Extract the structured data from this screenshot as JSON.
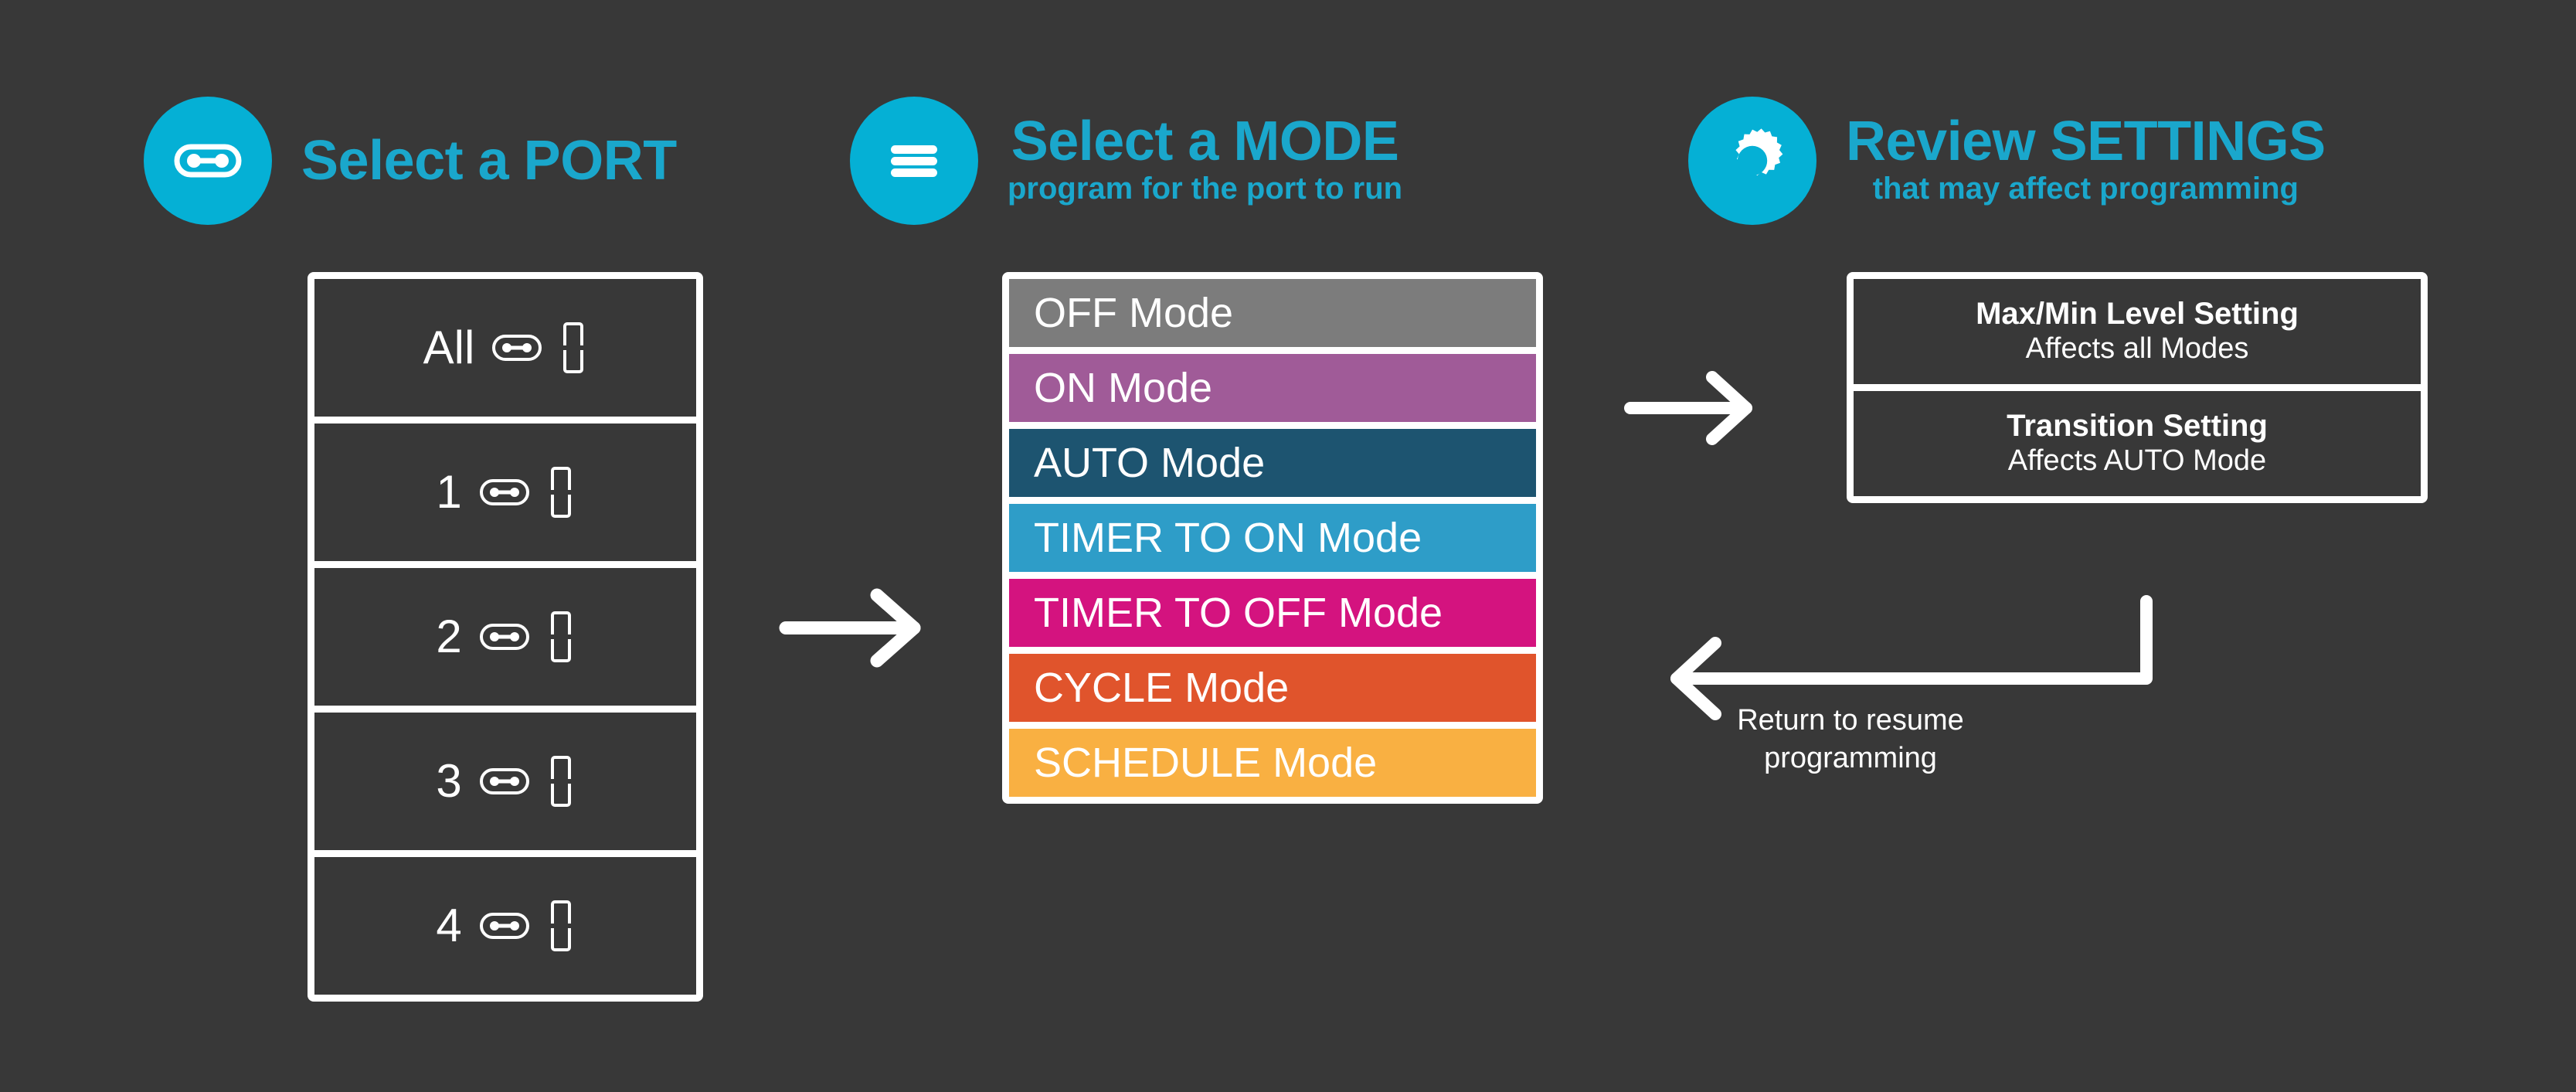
{
  "theme": {
    "background": "#383838",
    "accent": "#05b0d5",
    "accent_text": "#1aa7cc",
    "frame": "#ffffff",
    "panel": "#383838",
    "text": "#ffffff"
  },
  "sections": {
    "port": {
      "icon": "port-connector-icon",
      "title": "Select a PORT",
      "subtitle": ""
    },
    "mode": {
      "icon": "hamburger-menu-icon",
      "title": "Select a MODE",
      "subtitle": "program for the port to run"
    },
    "settings": {
      "icon": "gear-icon",
      "title": "Review SETTINGS",
      "subtitle": "that may affect programming"
    }
  },
  "ports": [
    {
      "label": "All",
      "port_icon": "port-connector-icon",
      "light_icon": "light-fixture-icon"
    },
    {
      "label": "1",
      "port_icon": "port-connector-icon",
      "light_icon": "light-fixture-icon"
    },
    {
      "label": "2",
      "port_icon": "port-connector-icon",
      "light_icon": "light-fixture-icon"
    },
    {
      "label": "3",
      "port_icon": "port-connector-icon",
      "light_icon": "light-fixture-icon"
    },
    {
      "label": "4",
      "port_icon": "port-connector-icon",
      "light_icon": "light-fixture-icon"
    }
  ],
  "modes": [
    {
      "label": "OFF Mode",
      "color": "#7c7c7c"
    },
    {
      "label": "ON Mode",
      "color": "#a05b98"
    },
    {
      "label": "AUTO Mode",
      "color": "#1d5470"
    },
    {
      "label": "TIMER TO ON Mode",
      "color": "#2e9dc8"
    },
    {
      "label": "TIMER TO OFF Mode",
      "color": "#d4137f"
    },
    {
      "label": "CYCLE Mode",
      "color": "#e0542c"
    },
    {
      "label": "SCHEDULE Mode",
      "color": "#f9b042"
    }
  ],
  "settings_items": [
    {
      "title": "Max/Min Level Setting",
      "subtitle": "Affects all Modes"
    },
    {
      "title": "Transition Setting",
      "subtitle": "Affects AUTO Mode"
    }
  ],
  "arrows": {
    "port_to_mode": "arrow-right-icon",
    "mode_to_settings": "arrow-right-icon",
    "settings_return": "arrow-return-left-icon",
    "return_note": "Return to resume\nprogramming"
  }
}
